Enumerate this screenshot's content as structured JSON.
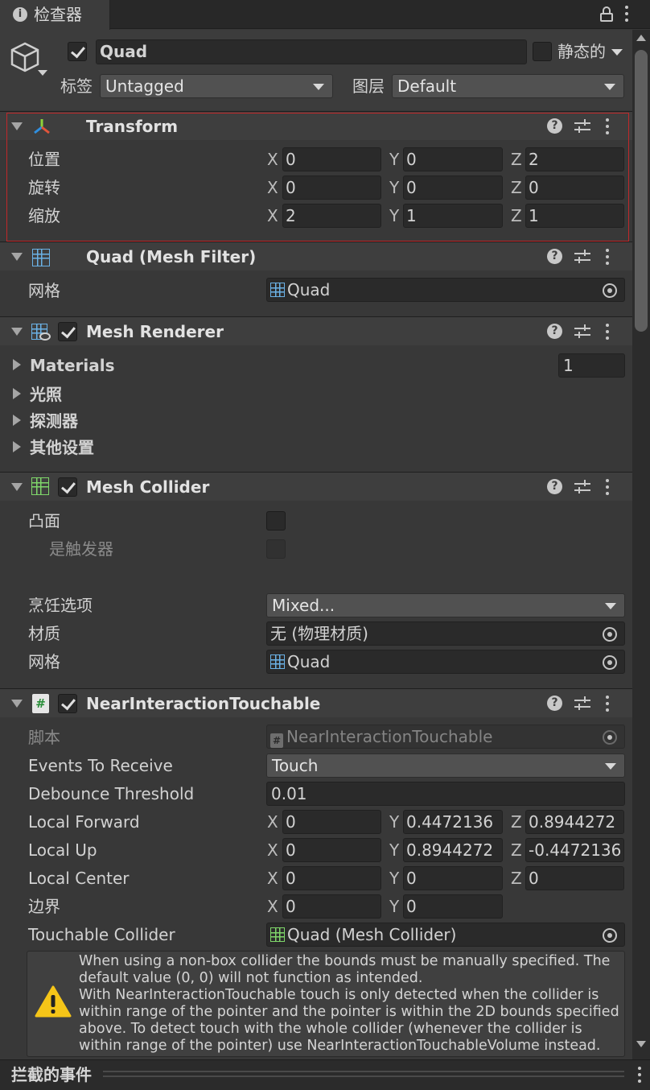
{
  "tab": {
    "title": "检查器"
  },
  "object": {
    "name": "Quad",
    "static_label": "静态的",
    "tag_label": "标签",
    "tag_value": "Untagged",
    "layer_label": "图层",
    "layer_value": "Default"
  },
  "transform": {
    "title": "Transform",
    "rows": [
      {
        "label": "位置",
        "x": "0",
        "y": "0",
        "z": "2"
      },
      {
        "label": "旋转",
        "x": "0",
        "y": "0",
        "z": "0"
      },
      {
        "label": "缩放",
        "x": "2",
        "y": "1",
        "z": "1"
      }
    ]
  },
  "mesh_filter": {
    "title": "Quad (Mesh Filter)",
    "mesh_label": "网格",
    "mesh_value": "Quad"
  },
  "mesh_renderer": {
    "title": "Mesh Renderer",
    "materials_label": "Materials",
    "materials_count": "1",
    "lighting_label": "光照",
    "probes_label": "探测器",
    "other_label": "其他设置"
  },
  "mesh_collider": {
    "title": "Mesh Collider",
    "convex_label": "凸面",
    "trigger_label": "是触发器",
    "cooking_label": "烹饪选项",
    "cooking_value": "Mixed...",
    "material_label": "材质",
    "material_value": "无 (物理材质)",
    "mesh_label": "网格",
    "mesh_value": "Quad"
  },
  "touchable": {
    "title": "NearInteractionTouchable",
    "script_label": "脚本",
    "script_value": "NearInteractionTouchable",
    "events_label": "Events To Receive",
    "events_value": "Touch",
    "debounce_label": "Debounce Threshold",
    "debounce_value": "0.01",
    "forward_label": "Local Forward",
    "forward": {
      "x": "0",
      "y": "0.4472136",
      "z": "0.8944272"
    },
    "up_label": "Local Up",
    "up": {
      "x": "0",
      "y": "0.8944272",
      "z": "-0.4472136"
    },
    "center_label": "Local Center",
    "center": {
      "x": "0",
      "y": "0",
      "z": "0"
    },
    "bounds_label": "边界",
    "bounds": {
      "x": "0",
      "y": "0"
    },
    "collider_label": "Touchable Collider",
    "collider_value": "Quad (Mesh Collider)",
    "warning_lines": [
      "When using a non-box collider the bounds must be manually specified. The",
      "default value (0, 0) will not function as intended.",
      "With NearInteractionTouchable touch is only detected when the collider is",
      "within range of the pointer and the pointer is within the 2D bounds specified",
      "above. To detect touch with the whole collider (whenever the collider is",
      "within range of the pointer) use NearInteractionTouchableVolume instead."
    ]
  },
  "footer": {
    "title": "拦截的事件"
  },
  "axes": {
    "x": "X",
    "y": "Y",
    "z": "Z"
  },
  "colors": {
    "background": "#383838",
    "header": "#3e3e3e",
    "field": "#2a2a2a",
    "highlight_border": "#c0282a",
    "warning": "#f5c518"
  }
}
